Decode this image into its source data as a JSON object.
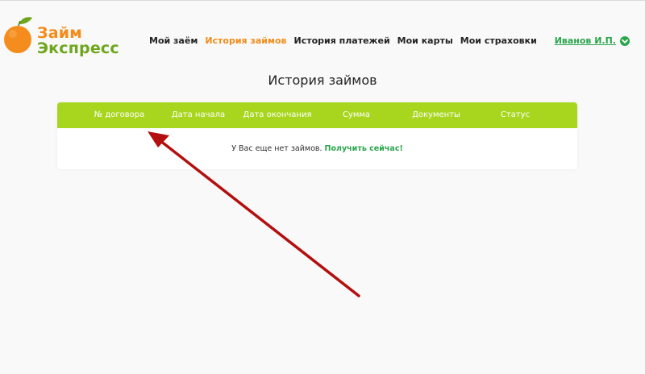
{
  "logo": {
    "line1": "Займ",
    "line2": "Экспресс"
  },
  "nav": {
    "items": [
      {
        "label": "Мой заём",
        "active": false
      },
      {
        "label": "История займов",
        "active": true
      },
      {
        "label": "История платежей",
        "active": false
      },
      {
        "label": "Мои карты",
        "active": false
      },
      {
        "label": "Мои страховки",
        "active": false
      }
    ]
  },
  "user": {
    "name": "Иванов И.П."
  },
  "page": {
    "title": "История займов"
  },
  "table": {
    "columns": [
      "№ договора",
      "Дата начала",
      "Дата окончания",
      "Сумма",
      "Документы",
      "Статус"
    ],
    "empty_text": "У Вас еще нет займов.",
    "empty_link": "Получить сейчас!"
  },
  "colors": {
    "brand_orange": "#f28c1a",
    "brand_green": "#6ea61d",
    "accent_green": "#2aa54b",
    "table_header": "#a8d61f",
    "annotation_arrow": "#b30f0f"
  }
}
